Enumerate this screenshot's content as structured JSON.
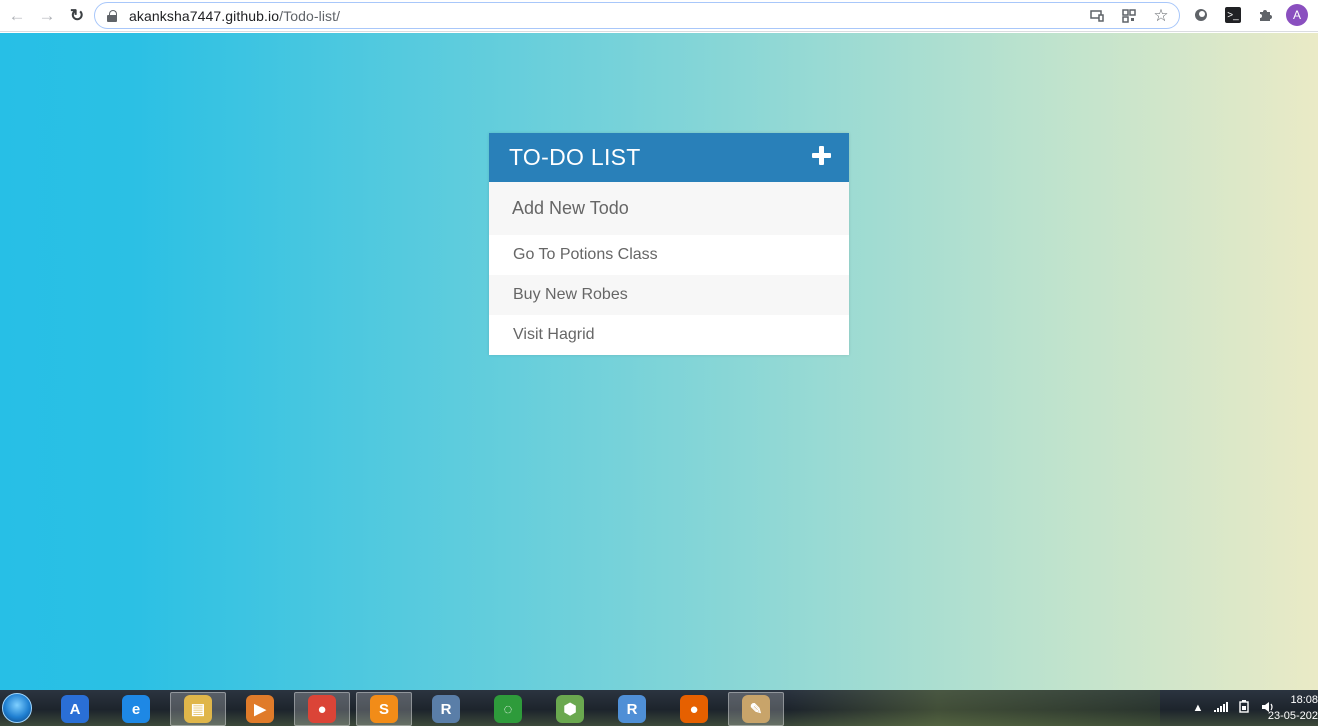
{
  "browser": {
    "url_host": "akanksha7447.github.io",
    "url_path": "/Todo-list/",
    "back_icon": "←",
    "forward_icon": "→",
    "reload_icon": "↻",
    "star_icon": "☆",
    "avatar_letter": "A"
  },
  "todo": {
    "title": "TO-DO LIST",
    "input_placeholder": "Add New Todo",
    "items": [
      {
        "label": "Go To Potions Class"
      },
      {
        "label": "Buy New Robes"
      },
      {
        "label": "Visit Hagrid"
      }
    ]
  },
  "taskbar": {
    "apps": [
      {
        "name": "android-studio-icon",
        "glyph": "A",
        "color": "#2a6fd6"
      },
      {
        "name": "internet-explorer-icon",
        "glyph": "e",
        "color": "#1e88e5"
      },
      {
        "name": "file-explorer-icon",
        "glyph": "▤",
        "color": "#e0b64a"
      },
      {
        "name": "media-player-icon",
        "glyph": "▶",
        "color": "#e07b2a"
      },
      {
        "name": "chrome-icon",
        "glyph": "●",
        "color": "#db4437"
      },
      {
        "name": "sublime-text-icon",
        "glyph": "S",
        "color": "#f28c18"
      },
      {
        "name": "rstudio-icon",
        "glyph": "R",
        "color": "#5a7ea8"
      },
      {
        "name": "loader-icon",
        "glyph": "◌",
        "color": "#2e9b3b"
      },
      {
        "name": "package-icon",
        "glyph": "⬢",
        "color": "#6aa84f"
      },
      {
        "name": "r-icon",
        "glyph": "R",
        "color": "#4f8fd6"
      },
      {
        "name": "firefox-icon",
        "glyph": "●",
        "color": "#e66000"
      },
      {
        "name": "paint-icon",
        "glyph": "✎",
        "color": "#c8a46a"
      }
    ],
    "time": "18:08",
    "date": "23-05-202"
  }
}
